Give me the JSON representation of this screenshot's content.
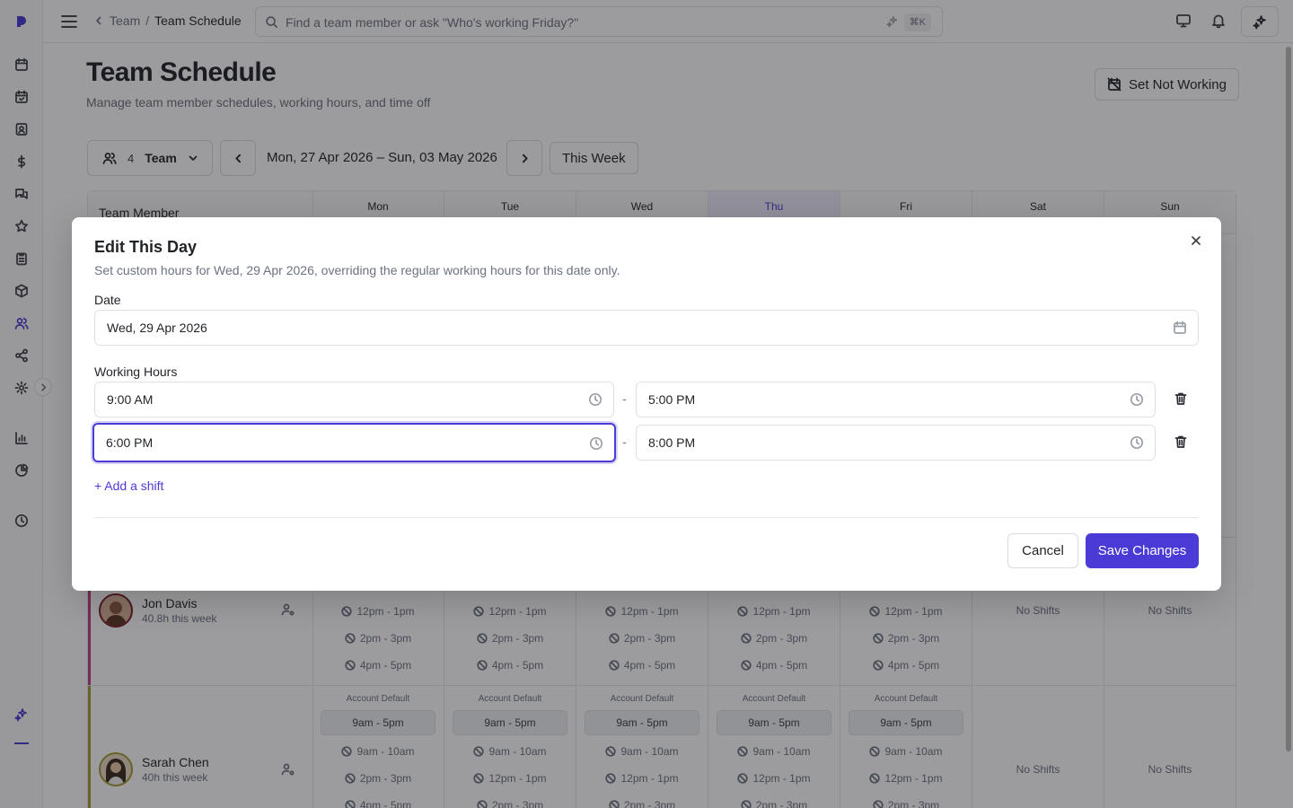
{
  "colors": {
    "accent": "#4b3bd6",
    "row_bar_jon": "#c33b86",
    "row_bar_sarah": "#a59c32"
  },
  "breadcrumb": {
    "parent": "Team",
    "separator": "/",
    "current": "Team Schedule"
  },
  "search": {
    "placeholder": "Find a team member or ask \"Who's working Friday?\"",
    "shortcut": "⌘K"
  },
  "page": {
    "title": "Team Schedule",
    "subtitle": "Manage team member schedules, working hours, and time off",
    "set_not_working": "Set Not Working"
  },
  "toolbar": {
    "team_count": "4",
    "team_label": "Team",
    "date_range": "Mon, 27 Apr 2026 – Sun, 03 May 2026",
    "this_week": "This Week"
  },
  "grid": {
    "member_header": "Team Member",
    "days": [
      "Mon",
      "Tue",
      "Wed",
      "Thu",
      "Fri",
      "Sat",
      "Sun"
    ],
    "members": [
      {
        "name": "Jon Davis",
        "hours": "40.8h this week",
        "slots": [
          "12pm - 1pm",
          "2pm - 3pm",
          "4pm - 5pm"
        ],
        "weekend": "No Shifts"
      },
      {
        "name": "Sarah Chen",
        "hours": "40h this week",
        "default_label": "Account Default",
        "default_hours": "9am - 5pm",
        "slots_mon": [
          "9am - 10am",
          "2pm - 3pm",
          "4pm - 5pm"
        ],
        "slots_rest": [
          "9am - 10am",
          "12pm - 1pm",
          "2pm - 3pm"
        ],
        "weekend": "No Shifts"
      }
    ]
  },
  "modal": {
    "title": "Edit This Day",
    "description": "Set custom hours for Wed, 29 Apr 2026, overriding the regular working hours for this date only.",
    "date_label": "Date",
    "date_value": "Wed, 29 Apr 2026",
    "hours_label": "Working Hours",
    "shifts": [
      {
        "start": "9:00 AM",
        "end": "5:00 PM"
      },
      {
        "start": "6:00 PM",
        "end": "8:00 PM"
      }
    ],
    "separator": "-",
    "add_shift": "+ Add a shift",
    "cancel": "Cancel",
    "save": "Save Changes"
  },
  "icons": [
    "logo-icon",
    "calendar-icon",
    "calendar-check-icon",
    "contact-icon",
    "dollar-icon",
    "chat-icon",
    "star-icon",
    "clipboard-icon",
    "box-icon",
    "users-icon",
    "share-icon",
    "gear-icon",
    "bar-chart-icon",
    "pie-chart-icon",
    "clock-icon",
    "sparkle-icon",
    "menu-icon",
    "search-icon",
    "monitor-icon",
    "bell-icon",
    "calendar-off-icon",
    "close-icon",
    "trash-icon",
    "user-settings-icon",
    "ban-icon"
  ]
}
